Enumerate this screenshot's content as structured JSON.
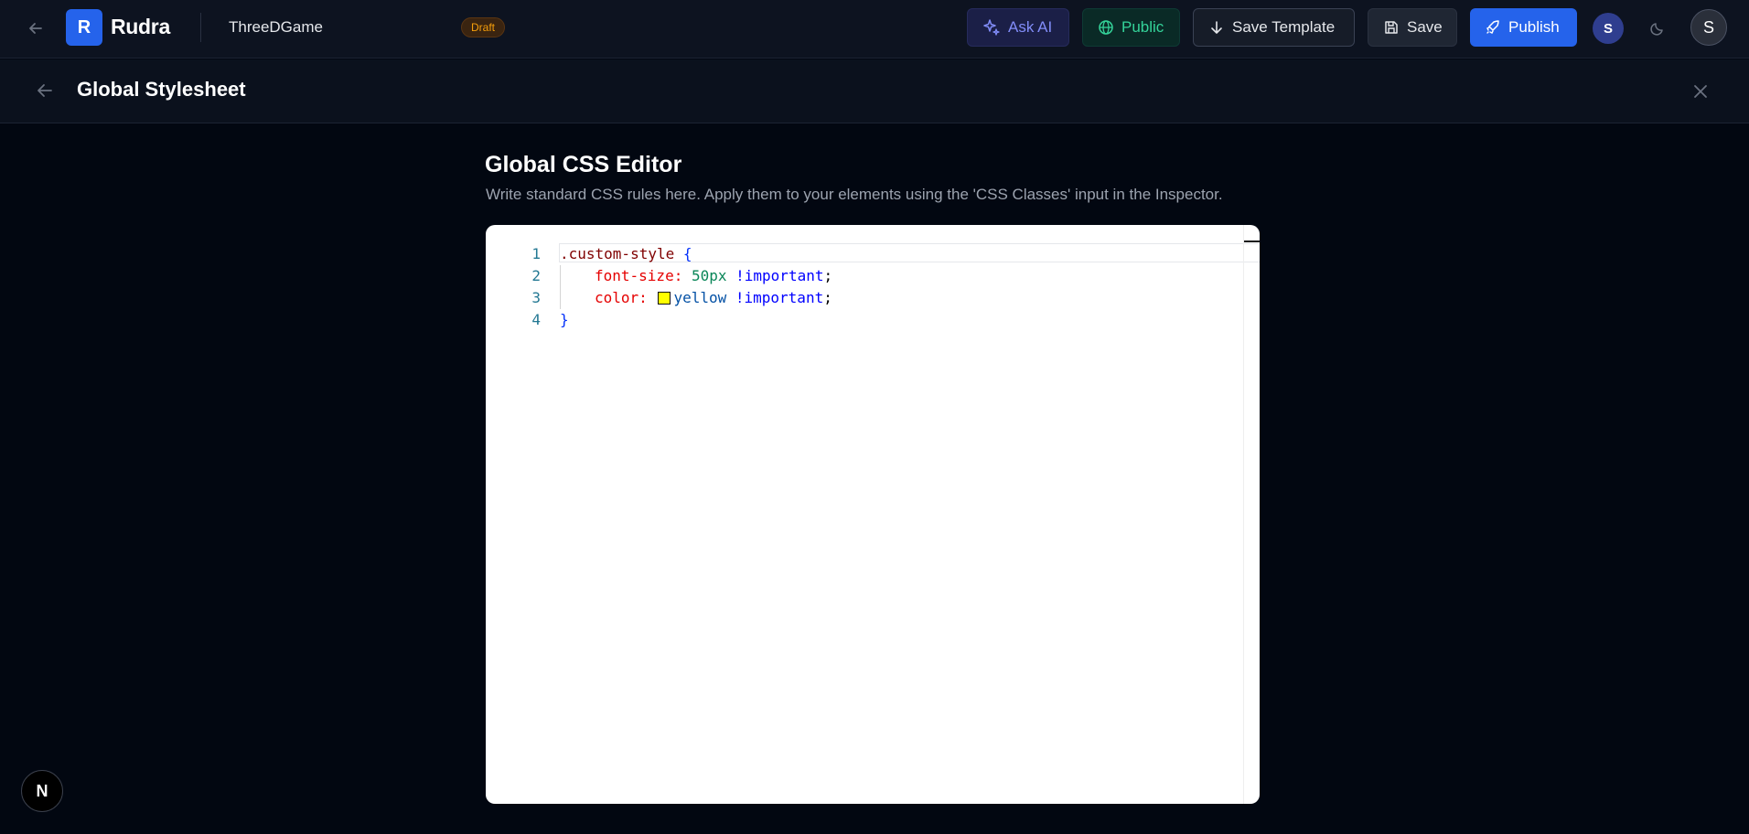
{
  "app": {
    "brand": "Rudra",
    "logo_letter": "R",
    "project_name": "ThreeDGame",
    "status_badge": "Draft"
  },
  "toolbar": {
    "ask_ai": "Ask AI",
    "public": "Public",
    "save_template": "Save Template",
    "save": "Save",
    "publish": "Publish",
    "user_initial_small": "S",
    "user_initial_large": "S"
  },
  "panel": {
    "title": "Global Stylesheet"
  },
  "editor": {
    "heading": "Global CSS Editor",
    "description": "Write standard CSS rules here. Apply them to your elements using the 'CSS Classes' input in the Inspector.",
    "line_numbers": [
      "1",
      "2",
      "3",
      "4"
    ],
    "code": {
      "selector": ".custom-style",
      "open_brace": "{",
      "prop1": "font-size:",
      "val1": "50px",
      "important1": "!important",
      "semi1": ";",
      "prop2": "color:",
      "val2": "yellow",
      "important2": "!important",
      "semi2": ";",
      "close_brace": "}"
    },
    "swatch_color": "#ffff00"
  },
  "badge": {
    "letter": "N"
  },
  "colors": {
    "accent": "#2563eb",
    "background": "#020711",
    "topbar": "#0d1320"
  },
  "icons": [
    "arrow-left-icon",
    "sparkles-icon",
    "globe-icon",
    "arrow-down-icon",
    "floppy-disk-icon",
    "rocket-icon",
    "moon-icon",
    "close-icon"
  ]
}
